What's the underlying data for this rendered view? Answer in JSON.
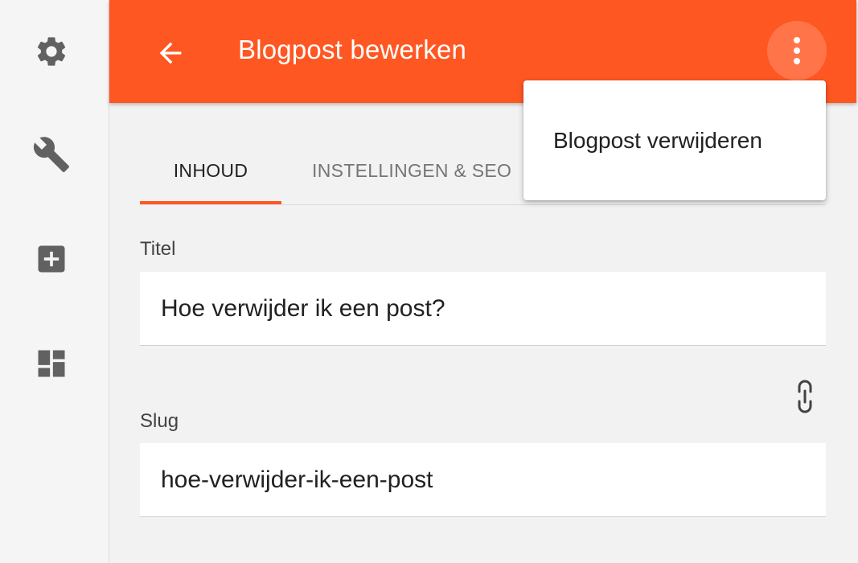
{
  "sidebar": {
    "icons": [
      "gear-icon",
      "wrench-icon",
      "add-box-icon",
      "dashboard-icon"
    ]
  },
  "appbar": {
    "title": "Blogpost bewerken",
    "back_icon": "arrow-left-icon",
    "more_icon": "more-vert-icon",
    "color": "#ff5722"
  },
  "tabs": [
    {
      "label": "INHOUD",
      "active": true
    },
    {
      "label": "INSTELLINGEN & SEO",
      "active": false
    }
  ],
  "form": {
    "title_label": "Titel",
    "title_value": "Hoe verwijder ik een post?",
    "slug_label": "Slug",
    "slug_value": "hoe-verwijder-ik-een-post",
    "slug_icon": "link-icon"
  },
  "menu": {
    "items": [
      {
        "label": "Blogpost verwijderen"
      }
    ]
  }
}
